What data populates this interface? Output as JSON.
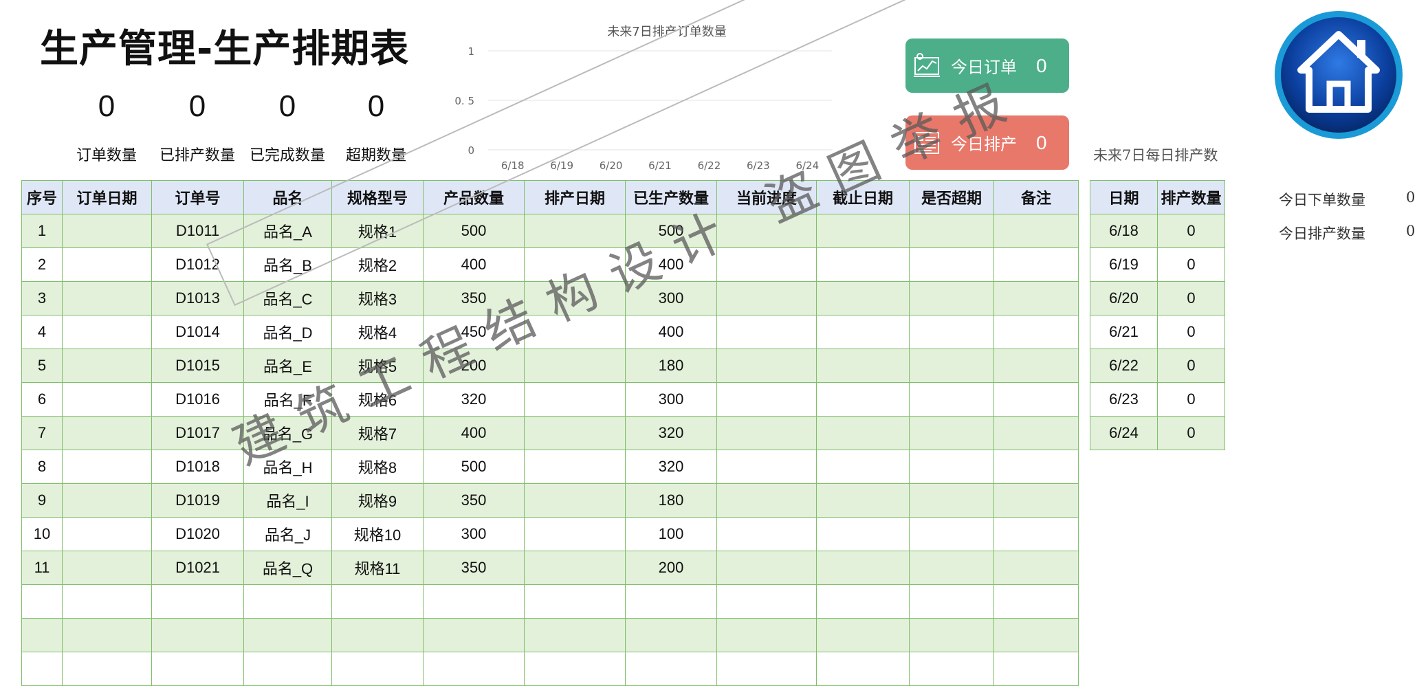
{
  "title": "生产管理-生产排期表",
  "kpis": [
    {
      "value": "0",
      "label": "订单数量"
    },
    {
      "value": "0",
      "label": "已排产数量"
    },
    {
      "value": "0",
      "label": "已完成数量"
    },
    {
      "value": "0",
      "label": "超期数量"
    }
  ],
  "chart_data": {
    "type": "line",
    "title": "未来7日排产订单数量",
    "categories": [
      "6/18",
      "6/19",
      "6/20",
      "6/21",
      "6/22",
      "6/23",
      "6/24"
    ],
    "series": [
      {
        "values": [
          0,
          0,
          0,
          0,
          0,
          0,
          0
        ]
      }
    ],
    "y_ticks": [
      "0",
      "0.5",
      "1"
    ],
    "ylim": [
      0,
      1
    ],
    "grid": true
  },
  "buttons": {
    "today_orders": {
      "label": "今日订单",
      "value": "0",
      "icon": "chart-board-icon",
      "color": "#4caf8a"
    },
    "today_schedule": {
      "label": "今日排产",
      "value": "0",
      "icon": "document-list-icon",
      "color": "#e8786a"
    }
  },
  "side_caption": "未来7日每日排产数",
  "home_icon": "home-icon",
  "right_stats": [
    {
      "label": "今日下单数量",
      "value": "0"
    },
    {
      "label": "今日排产数量",
      "value": "0"
    }
  ],
  "main_table": {
    "headers": [
      "序号",
      "订单日期",
      "订单号",
      "品名",
      "规格型号",
      "产品数量",
      "排产日期",
      "已生产数量",
      "当前进度",
      "截止日期",
      "是否超期",
      "备注"
    ],
    "rows": [
      [
        "1",
        "",
        "D1011",
        "品名_A",
        "规格1",
        "500",
        "",
        "500",
        "",
        "",
        "",
        ""
      ],
      [
        "2",
        "",
        "D1012",
        "品名_B",
        "规格2",
        "400",
        "",
        "400",
        "",
        "",
        "",
        ""
      ],
      [
        "3",
        "",
        "D1013",
        "品名_C",
        "规格3",
        "350",
        "",
        "300",
        "",
        "",
        "",
        ""
      ],
      [
        "4",
        "",
        "D1014",
        "品名_D",
        "规格4",
        "450",
        "",
        "400",
        "",
        "",
        "",
        ""
      ],
      [
        "5",
        "",
        "D1015",
        "品名_E",
        "规格5",
        "200",
        "",
        "180",
        "",
        "",
        "",
        ""
      ],
      [
        "6",
        "",
        "D1016",
        "品名_F",
        "规格6",
        "320",
        "",
        "300",
        "",
        "",
        "",
        ""
      ],
      [
        "7",
        "",
        "D1017",
        "品名_G",
        "规格7",
        "400",
        "",
        "320",
        "",
        "",
        "",
        ""
      ],
      [
        "8",
        "",
        "D1018",
        "品名_H",
        "规格8",
        "500",
        "",
        "320",
        "",
        "",
        "",
        ""
      ],
      [
        "9",
        "",
        "D1019",
        "品名_I",
        "规格9",
        "350",
        "",
        "180",
        "",
        "",
        "",
        ""
      ],
      [
        "10",
        "",
        "D1020",
        "品名_J",
        "规格10",
        "300",
        "",
        "100",
        "",
        "",
        "",
        ""
      ],
      [
        "11",
        "",
        "D1021",
        "品名_Q",
        "规格11",
        "350",
        "",
        "200",
        "",
        "",
        "",
        ""
      ],
      [
        "",
        "",
        "",
        "",
        "",
        "",
        "",
        "",
        "",
        "",
        "",
        ""
      ],
      [
        "",
        "",
        "",
        "",
        "",
        "",
        "",
        "",
        "",
        "",
        "",
        ""
      ],
      [
        "",
        "",
        "",
        "",
        "",
        "",
        "",
        "",
        "",
        "",
        "",
        ""
      ]
    ]
  },
  "date_table": {
    "headers": [
      "日期",
      "排产数量"
    ],
    "rows": [
      [
        "6/18",
        "0"
      ],
      [
        "6/19",
        "0"
      ],
      [
        "6/20",
        "0"
      ],
      [
        "6/21",
        "0"
      ],
      [
        "6/22",
        "0"
      ],
      [
        "6/23",
        "0"
      ],
      [
        "6/24",
        "0"
      ]
    ]
  },
  "watermark": "建筑工程结构设计 盗图举报"
}
